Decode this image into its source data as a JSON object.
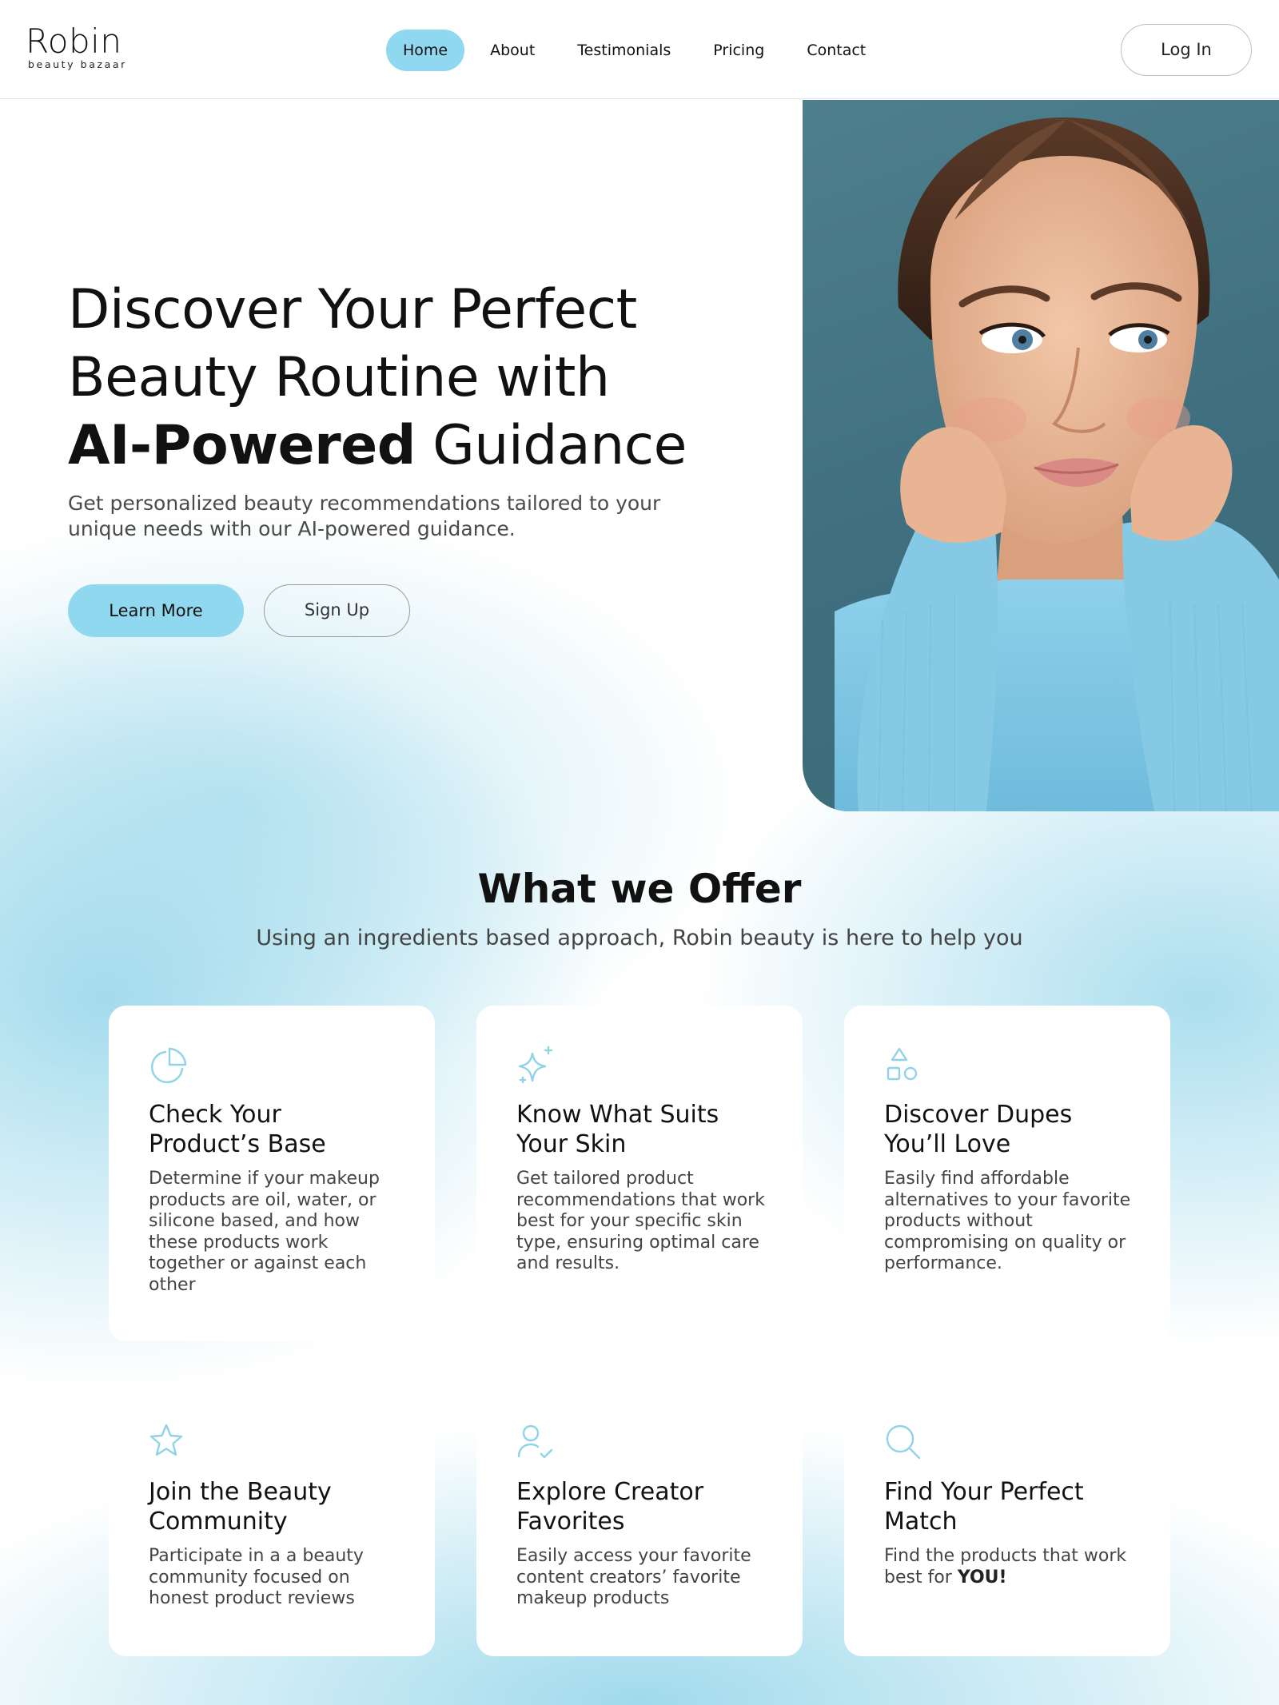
{
  "brand": {
    "name": "Robin",
    "tagline": "beauty bazaar"
  },
  "nav": {
    "items": [
      {
        "label": "Home",
        "active": true
      },
      {
        "label": "About",
        "active": false
      },
      {
        "label": "Testimonials",
        "active": false
      },
      {
        "label": "Pricing",
        "active": false
      },
      {
        "label": "Contact",
        "active": false
      }
    ],
    "login_label": "Log In"
  },
  "hero": {
    "title_line1": "Discover Your Perfect",
    "title_line2": "Beauty Routine with",
    "title_bold": "AI-Powered",
    "title_rest": " Guidance",
    "subtitle": "Get personalized beauty recommendations tailored to your unique needs with our AI-powered guidance.",
    "primary_button": "Learn More",
    "secondary_button": "Sign Up"
  },
  "offer": {
    "title": "What we Offer",
    "subtitle": "Using an ingredients based approach, Robin beauty is here to help you",
    "cards": [
      {
        "icon": "pie-chart-icon",
        "title": "Check Your Product’s Base",
        "text": "Determine if your makeup products are oil, water, or silicone based, and how these products work together or against each other"
      },
      {
        "icon": "sparkle-icon",
        "title": "Know What Suits Your Skin",
        "text": "Get tailored product recommendations that work best for your specific skin type, ensuring optimal care and results."
      },
      {
        "icon": "shapes-icon",
        "title": "Discover Dupes You’ll Love",
        "text": "Easily find affordable alternatives to your favorite products without compromising on quality or performance."
      },
      {
        "icon": "star-icon",
        "title": "Join the Beauty Community",
        "text": "Participate in a a beauty community focused on honest product reviews"
      },
      {
        "icon": "user-check-icon",
        "title": "Explore Creator Favorites",
        "text": "Easily access your favorite content creators’ favorite makeup products"
      },
      {
        "icon": "search-icon",
        "title": "Find Your Perfect Match",
        "text_plain": "Find the products that work best for ",
        "text_bold": "YOU!"
      }
    ]
  },
  "colors": {
    "accent": "#8fd8ef",
    "icon": "#8fd3e8",
    "text": "#111111",
    "muted": "#444444"
  }
}
